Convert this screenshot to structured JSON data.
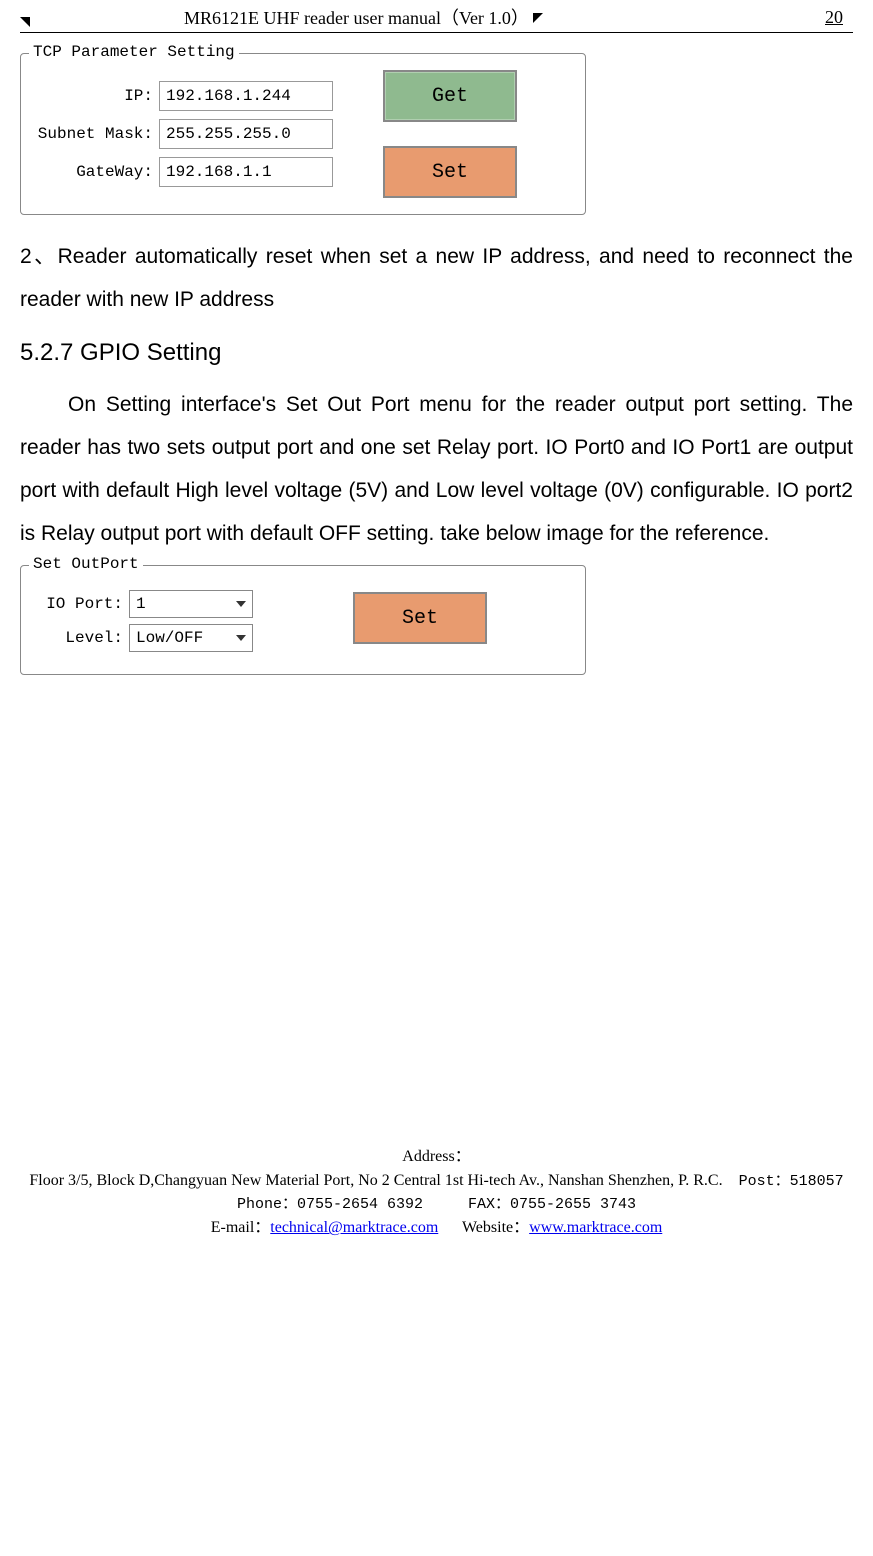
{
  "header": {
    "title": "MR6121E UHF reader user manual（Ver 1.0）",
    "page_number": "20"
  },
  "tcp_panel": {
    "title": "TCP Parameter Setting",
    "ip_label": "IP:",
    "ip_value": "192.168.1.244",
    "subnet_label": "Subnet Mask:",
    "subnet_value": "255.255.255.0",
    "gateway_label": "GateWay:",
    "gateway_value": "192.168.1.1",
    "get_button": "Get",
    "set_button": "Set"
  },
  "paragraph_2": {
    "text": "2、Reader automatically reset when set a new IP address, and need to reconnect the reader with new IP address"
  },
  "section_heading": "5.2.7 GPIO Setting",
  "paragraph_gpio": {
    "text": "On Setting interface's Set Out Port menu for the reader output port setting. The reader has two sets output port and one set Relay port. IO Port0 and IO Port1 are output port with default High level voltage (5V) and Low level voltage (0V) configurable. IO port2 is Relay output port with default OFF setting. take below image for the reference."
  },
  "outport_panel": {
    "title": "Set OutPort",
    "io_port_label": "IO Port:",
    "io_port_value": "1",
    "level_label": "Level:",
    "level_value": "Low/OFF",
    "set_button": "Set"
  },
  "footer": {
    "address_label": "Address：",
    "address_line": "Floor 3/5, Block D,Changyuan New  Material Port, No 2 Central 1st Hi-tech Av., Nanshan Shenzhen, P. R.C.",
    "post_label": "Post：",
    "post_value": "518057",
    "phone_label": "Phone：",
    "phone_value": "0755-2654 6392",
    "fax_label": "FAX：",
    "fax_value": "0755-2655 3743",
    "email_label": "E-mail：",
    "email_value": "technical@marktrace.com",
    "website_label": "Website：",
    "website_value": "www.marktrace.com"
  }
}
